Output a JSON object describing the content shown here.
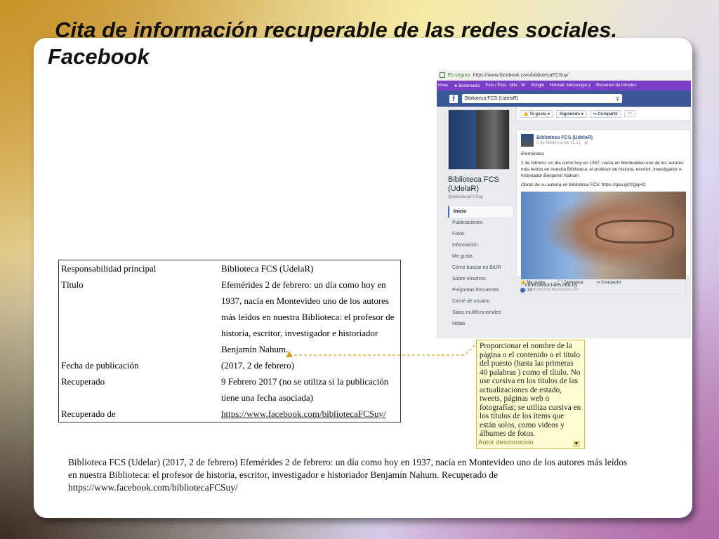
{
  "slide": {
    "title_line1": "Cita de información recuperable de las redes sociales.",
    "title_line2": "Facebook"
  },
  "browser": {
    "secure_label": "Es seguro",
    "url": "https://www.facebook.com/bibliotecaFCSuy/",
    "bookmarks": [
      "iones",
      "Bookmarks",
      "Esta / Ésta - tilde - W",
      "Google",
      "Hotmail, Messenger y",
      "Resumen de Introduc"
    ],
    "search_value": "Biblioteca FCS (UdelaR)",
    "page_name": "Biblioteca FCS (UdelaR)",
    "handle": "@bibliotecaFCSuy",
    "nav": [
      "Inicio",
      "Publicaciones",
      "Fotos",
      "Información",
      "Me gusta",
      "Cómo buscar en BiUR",
      "Sobre nosotros",
      "Preguntas frecuentes",
      "Carné de usuario",
      "Salas multifuncionales",
      "Notas"
    ],
    "actions": {
      "like": "Te gusta",
      "following": "Siguiendo",
      "share": "Compartir",
      "more": "···"
    },
    "post": {
      "author": "Biblioteca FCS (UdelaR)",
      "date": "2 de febrero a las 11:21 · ",
      "heading": "Efemérides",
      "body": "2 de febrero: un día como hoy en 1937, nacía en Montevideo uno de los autores más leídos en nuestra Biblioteca: el profesor de historia, escritor, investigador e historiador Benjamín Nahum.",
      "works": "Obras de su autoría en Biblioteca FCS: https://goo.gl/XQpp42",
      "link_title": "cienciassociales.edu.uy",
      "link_domain": "CIENCIASSOCIALES.EDU.UY",
      "react_like": "Me gusta",
      "react_comment": "Comentar",
      "react_share": "Compartir",
      "like_count": "12"
    }
  },
  "citation": {
    "rows": [
      {
        "key": "Responsabilidad principal",
        "value": "Biblioteca FCS (UdelaR)"
      },
      {
        "key": "Título",
        "value": "Efemérides 2 de febrero: un día como hoy en 1937, nacía en Montevideo uno de los autores más leídos en nuestra Biblioteca: el profesor de historia, escritor, investigador e historiador Benjamín Nahum."
      },
      {
        "key": "Fecha de publicación",
        "value": "(2017, 2 de febrero)"
      },
      {
        "key": "Recuperado",
        "value": "9 Febrero 2017 (no se utiliza si la publicación tiene una fecha asociada)"
      },
      {
        "key": "Recuperado de",
        "value": "https://www.facebook.com/bibliotecaFCSuy/"
      }
    ]
  },
  "note": {
    "text": "Proporcionar el nombre de la página o el contenido o el título del puesto (hasta las primeras 40 palabras ) como el título. No use cursiva en los títulos de las actualizaciones de estado, tweets, páginas web o fotografías; se utiliza cursiva en los títulos de los ítems que están solos, como videos y álbumes de fotos.",
    "author": "Autor desconocido"
  },
  "reference": {
    "text": "Biblioteca FCS (Udelar) (2017, 2 de febrero) Efemérides 2 de febrero: un día como hoy en 1937, nacía en Montevideo uno de los       autores más leídos en nuestra Biblioteca: el profesor de historia, escritor, investigador e historiador Benjamín Nahum. Recuperado de https://www.facebook.com/bibliotecaFCSuy/"
  },
  "colors": {
    "facebook_blue": "#3b5998",
    "bookmark_bar": "#7b3ec9",
    "note_bg": "#fdfbd0",
    "connector": "#d8a020"
  }
}
